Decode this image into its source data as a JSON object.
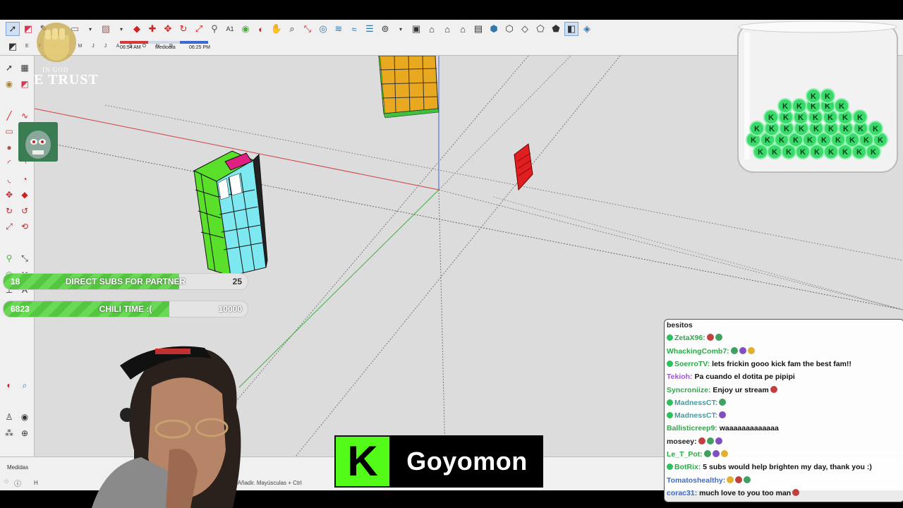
{
  "app": {
    "status_label": "Medidas",
    "status_hint_prefix": "H",
    "status_hint": "aer. Ctrl = Añadir. Mayúsculas + Ctrl"
  },
  "timeline": {
    "months": "E F M A M J J A S O N D",
    "start_time": "06:54 AM",
    "mid_label": "Mediodía",
    "end_time": "06:25 PM"
  },
  "toolbar": {
    "icons": [
      "select-icon",
      "eraser-icon",
      "line-icon",
      "arc-icon",
      "rectangle-icon",
      "push-pull-icon",
      "move-icon",
      "rotate-icon",
      "scale-icon",
      "offset-icon",
      "tape-icon",
      "text-icon",
      "paint-icon",
      "orbit-icon",
      "pan-icon",
      "zoom-icon",
      "zoom-extents-icon",
      "section-icon",
      "sandbox-icon",
      "layers-icon",
      "components-icon",
      "home-icon",
      "house-icon",
      "box-icon",
      "iso-view-icon",
      "top-view-icon",
      "front-view-icon",
      "right-view-icon",
      "back-view-icon",
      "left-view-icon",
      "xray-icon",
      "wireframe-icon"
    ]
  },
  "overlay": {
    "emblem_line1": "IN GOD",
    "emblem_line2": "E TRUST",
    "goals": [
      {
        "current": "18",
        "title": "DIRECT SUBS FOR PARTNER",
        "target": "25",
        "progress": 0.72
      },
      {
        "current": "6823",
        "title": "CHILI TIME :(",
        "target": "10000",
        "progress": 0.68
      }
    ],
    "streamer_name": "Goyomon",
    "platform_logo": "K"
  },
  "chat": {
    "messages": [
      {
        "user": "besitos",
        "text": "",
        "color": "#222222",
        "badge": false,
        "emotes": 0
      },
      {
        "user": "ZetaX96:",
        "text": "",
        "color": "#2ea84a",
        "badge": true,
        "emotes": 2
      },
      {
        "user": "WhackingComb7:",
        "text": "",
        "color": "#2ea84a",
        "badge": false,
        "emotes": 3
      },
      {
        "user": "SoerroTV:",
        "text": "lets frickin gooo kick fam the best fam!!",
        "color": "#2ea84a",
        "badge": true,
        "emotes": 0
      },
      {
        "user": "Tekioh:",
        "text": "Pa cuando el dotita pe pipipi",
        "color": "#9b59d0",
        "badge": false,
        "emotes": 0
      },
      {
        "user": "Syncroniize:",
        "text": "Enjoy ur stream",
        "color": "#2ea84a",
        "badge": false,
        "emotes": 1
      },
      {
        "user": "MadnessCT:",
        "text": "",
        "color": "#3da0a0",
        "badge": true,
        "emotes": 1
      },
      {
        "user": "MadnessCT:",
        "text": "",
        "color": "#3da0a0",
        "badge": true,
        "emotes": 1
      },
      {
        "user": "Ballisticreep9:",
        "text": "waaaaaaaaaaaaa",
        "color": "#2ea84a",
        "badge": false,
        "emotes": 0
      },
      {
        "user": "moseey:",
        "text": "",
        "color": "#222222",
        "badge": false,
        "emotes": 3
      },
      {
        "user": "Le_T_Pot:",
        "text": "",
        "color": "#2ea84a",
        "badge": false,
        "emotes": 3
      },
      {
        "user": "BotRix:",
        "text": "5 subs would help brighten my day, thank you :)",
        "color": "#2ea84a",
        "badge": true,
        "emotes": 0
      },
      {
        "user": "Tomatoshealthy:",
        "text": "",
        "color": "#3b6bd2",
        "badge": false,
        "emotes": 3
      },
      {
        "user": "corac31:",
        "text": "much love to you too man",
        "color": "#3b6bd2",
        "badge": false,
        "emotes": 1
      }
    ]
  },
  "colors": {
    "kick_green": "#53fc18",
    "goal_green": "#55c640",
    "axis_red": "#d04040",
    "axis_green": "#3cb043",
    "axis_blue": "#4060d0"
  }
}
